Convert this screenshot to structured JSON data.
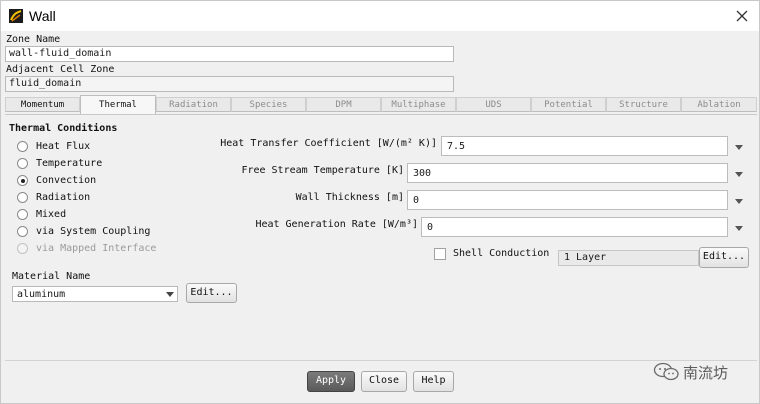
{
  "window": {
    "title": "Wall"
  },
  "zone": {
    "zone_name_label": "Zone Name",
    "zone_name_value": "wall-fluid_domain",
    "adjacent_label": "Adjacent Cell Zone",
    "adjacent_value": "fluid_domain"
  },
  "tabs": [
    {
      "label": "Momentum",
      "state": "enabled"
    },
    {
      "label": "Thermal",
      "state": "active"
    },
    {
      "label": "Radiation",
      "state": "disabled"
    },
    {
      "label": "Species",
      "state": "disabled"
    },
    {
      "label": "DPM",
      "state": "disabled"
    },
    {
      "label": "Multiphase",
      "state": "disabled"
    },
    {
      "label": "UDS",
      "state": "disabled"
    },
    {
      "label": "Potential",
      "state": "disabled"
    },
    {
      "label": "Structure",
      "state": "disabled"
    },
    {
      "label": "Ablation",
      "state": "disabled"
    }
  ],
  "thermal": {
    "group_title": "Thermal Conditions",
    "options": [
      {
        "label": "Heat Flux",
        "selected": false,
        "enabled": true
      },
      {
        "label": "Temperature",
        "selected": false,
        "enabled": true
      },
      {
        "label": "Convection",
        "selected": true,
        "enabled": true
      },
      {
        "label": "Radiation",
        "selected": false,
        "enabled": true
      },
      {
        "label": "Mixed",
        "selected": false,
        "enabled": true
      },
      {
        "label": "via System Coupling",
        "selected": false,
        "enabled": true
      },
      {
        "label": "via Mapped Interface",
        "selected": false,
        "enabled": false
      }
    ]
  },
  "material": {
    "label": "Material Name",
    "value": "aluminum",
    "edit_label": "Edit..."
  },
  "properties": [
    {
      "label": "Heat Transfer Coefficient [W/(m² K)]",
      "value": "7.5"
    },
    {
      "label": "Free Stream Temperature [K]",
      "value": "300"
    },
    {
      "label": "Wall Thickness [m]",
      "value": "0"
    },
    {
      "label": "Heat Generation Rate [W/m³]",
      "value": "0"
    }
  ],
  "shell": {
    "label": "Shell Conduction",
    "checked": false,
    "layers_value": "1 Layer",
    "edit_label": "Edit..."
  },
  "buttons": {
    "apply": "Apply",
    "close": "Close",
    "help": "Help"
  },
  "watermark": {
    "text": "南流坊"
  },
  "icons": {
    "app": "fluent-app-icon",
    "close": "close-icon",
    "dropdown": "chevron-down-icon",
    "watermark": "wechat-icon"
  },
  "colors": {
    "apply_button": "#6a6a6a",
    "dialog_bg": "#f0f0f0"
  }
}
